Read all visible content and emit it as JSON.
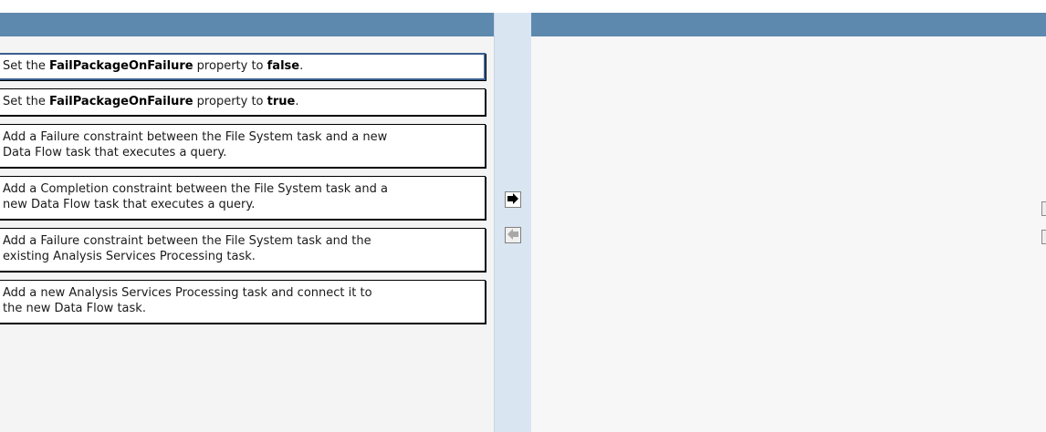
{
  "answer_choices": [
    {
      "before": "Set the ",
      "bold": "FailPackageOnFailure",
      "middle": " property to ",
      "bold2": "false",
      "after": ".",
      "selected": true
    },
    {
      "before": "Set the ",
      "bold": "FailPackageOnFailure",
      "middle": " property to ",
      "bold2": "true",
      "after": ".",
      "selected": false
    },
    {
      "line1": "Add a Failure constraint between the File System task and a new",
      "line2": "Data Flow task that executes a query."
    },
    {
      "line1": "Add a Completion constraint between the File System task and a",
      "line2": "new Data Flow task that executes a query."
    },
    {
      "line1": "Add a Failure constraint between the File System task and the",
      "line2": "existing Analysis Services Processing task."
    },
    {
      "line1": "Add a new Analysis Services Processing task and connect it to",
      "line2": "the new Data Flow task."
    }
  ],
  "controls": {
    "move_right_icon": "arrow-right-icon",
    "move_left_icon": "arrow-left-icon"
  },
  "colors": {
    "header": "#5d89ae",
    "middle_strip": "#d9e5f1",
    "selected_border": "#3b5f8e"
  }
}
